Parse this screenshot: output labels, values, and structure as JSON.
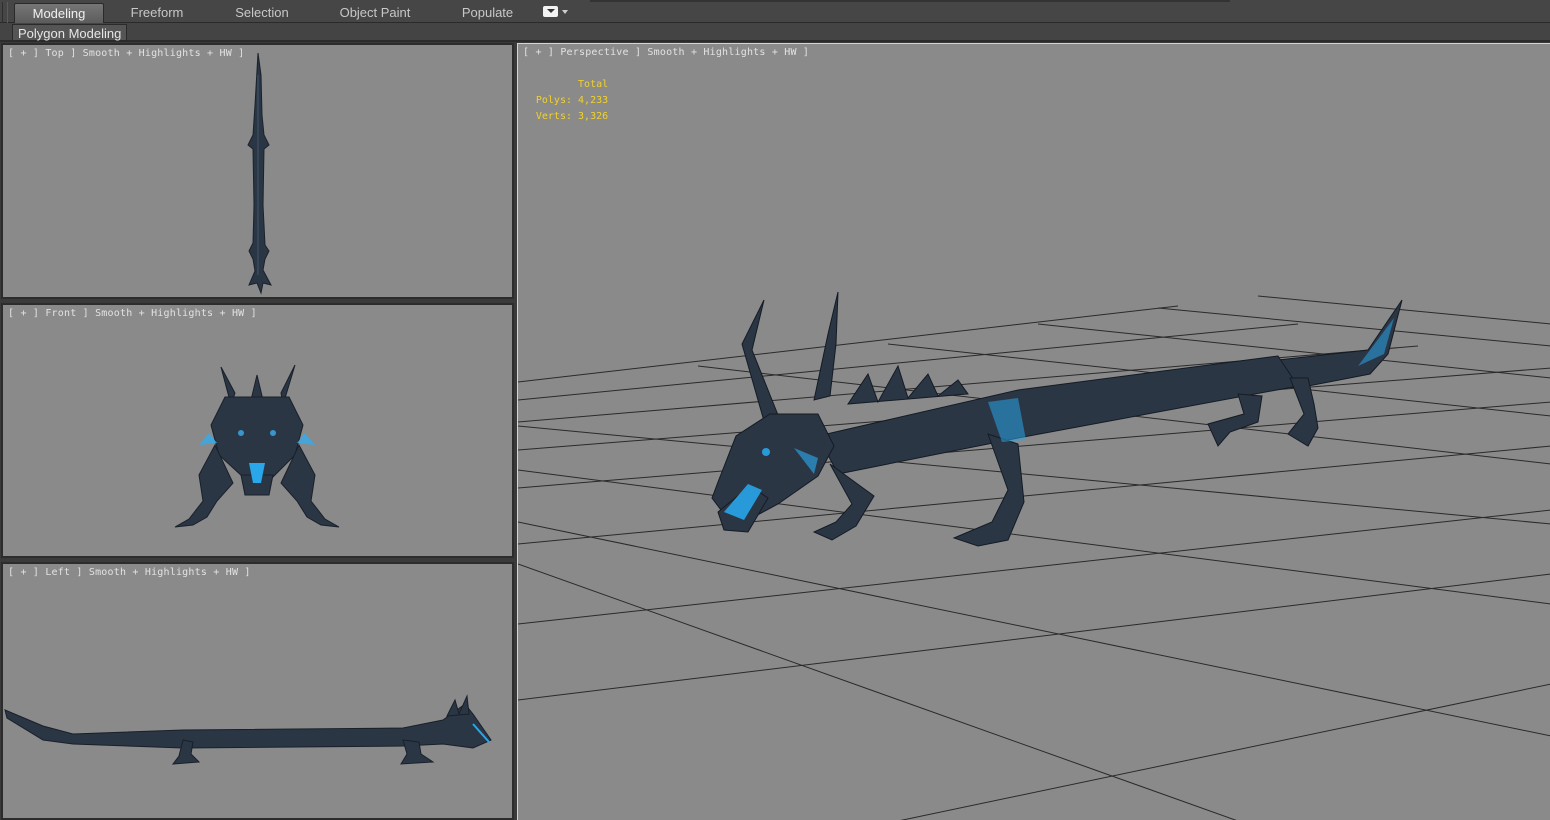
{
  "ribbon": {
    "tabs": [
      {
        "label": "Modeling",
        "active": true
      },
      {
        "label": "Freeform",
        "active": false
      },
      {
        "label": "Selection",
        "active": false
      },
      {
        "label": "Object Paint",
        "active": false
      },
      {
        "label": "Populate",
        "active": false
      }
    ],
    "dropdown_icon": "ribbon-options-dropdown-icon"
  },
  "panel": {
    "label": "Polygon Modeling"
  },
  "viewports": {
    "top": {
      "label": "[ + ] Top ] Smooth + Highlights + HW ]"
    },
    "front": {
      "label": "[ + ] Front ] Smooth + Highlights + HW ]"
    },
    "left": {
      "label": "[ + ] Left ] Smooth + Highlights + HW ]"
    },
    "perspective": {
      "label": "[ + ] Perspective ] Smooth + Highlights + HW ]",
      "stats": {
        "header": "Total",
        "polys_label": "Polys:",
        "polys_value": "4,233",
        "verts_label": "Verts:",
        "verts_value": "3,326"
      }
    }
  },
  "colors": {
    "viewport_bg": "#8a8a8a",
    "stats_text": "#f2d22a",
    "dragon_body": "#2b3645",
    "dragon_glow": "#2aa6ea",
    "grid": "#2a2a2a"
  }
}
